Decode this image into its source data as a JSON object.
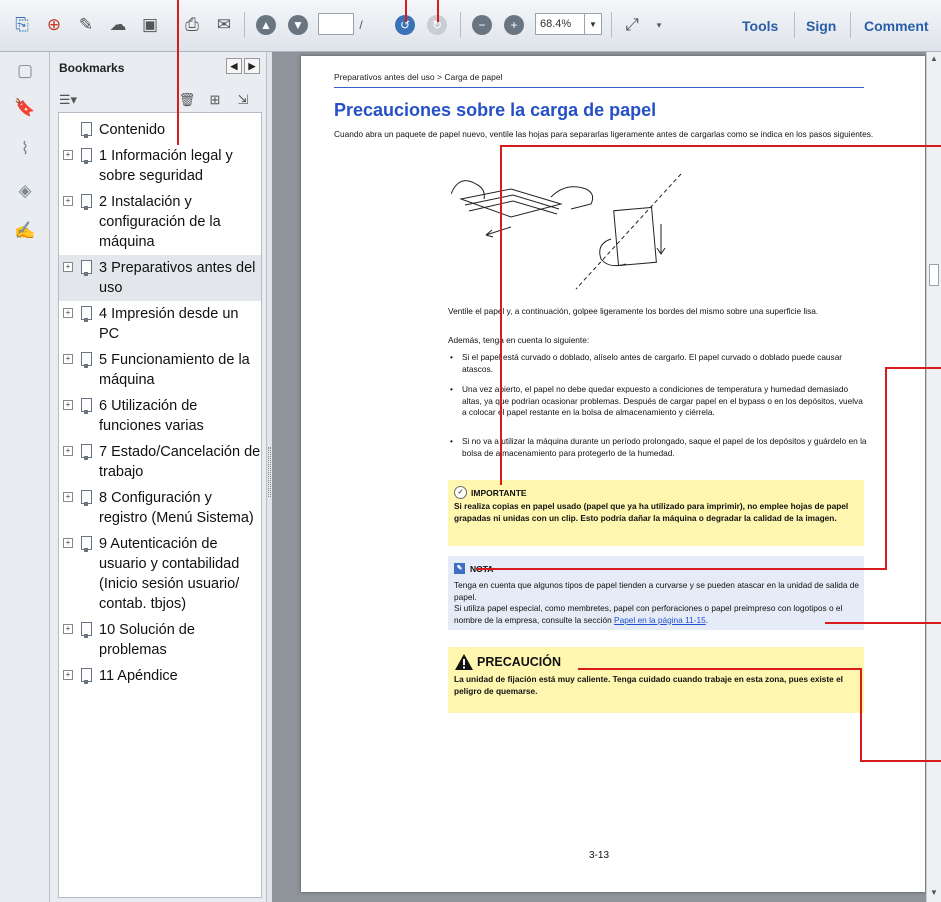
{
  "toolbar": {
    "page_current": "",
    "page_separator": "/",
    "page_total": "",
    "zoom": "68.4%",
    "tools_label": "Tools",
    "sign_label": "Sign",
    "comment_label": "Comment"
  },
  "bookmarks": {
    "title": "Bookmarks",
    "items": [
      {
        "label": "Contenido",
        "expandable": false,
        "selected": false
      },
      {
        "label": "1 Información legal y sobre seguridad",
        "expandable": true,
        "selected": false
      },
      {
        "label": "2 Instalación y configuración de la máquina",
        "expandable": true,
        "selected": false
      },
      {
        "label": "3 Preparativos antes del uso",
        "expandable": true,
        "selected": true
      },
      {
        "label": "4 Impresión desde un PC",
        "expandable": true,
        "selected": false
      },
      {
        "label": "5 Funcionamiento de la máquina",
        "expandable": true,
        "selected": false
      },
      {
        "label": "6 Utilización de funciones varias",
        "expandable": true,
        "selected": false
      },
      {
        "label": "7 Estado/Cancelación de trabajo",
        "expandable": true,
        "selected": false
      },
      {
        "label": "8 Configuración y registro (Menú Sistema)",
        "expandable": true,
        "selected": false
      },
      {
        "label": "9 Autenticación de usuario y contabilidad (Inicio sesión usuario/ contab. tbjos)",
        "expandable": true,
        "selected": false
      },
      {
        "label": "10 Solución de problemas",
        "expandable": true,
        "selected": false
      },
      {
        "label": "11 Apéndice",
        "expandable": true,
        "selected": false
      }
    ]
  },
  "document": {
    "breadcrumb": "Preparativos antes del uso > Carga de papel",
    "title": "Precauciones sobre la carga de papel",
    "intro": "Cuando abra un paquete de papel nuevo, ventile las hojas para separarlas ligeramente antes de cargarlas como se indica en los pasos siguientes.",
    "para1": "Ventile el papel y, a continuación, golpee ligeramente los bordes del mismo sobre una superficie lisa.",
    "para2": "Además, tenga en cuenta lo siguiente:",
    "bullet1": "Si el papel está curvado o doblado, alíselo antes de cargarlo. El papel curvado o doblado puede causar atascos.",
    "bullet2": "Una vez abierto, el papel no debe quedar expuesto a condiciones de temperatura y humedad demasiado altas, ya que podrían ocasionar problemas. Después de cargar papel en el bypass o en los depósitos, vuelva a colocar el papel restante en la bolsa de almacenamiento y ciérrela.",
    "bullet3": "Si no va a utilizar la máquina durante un período prolongado, saque el papel de los depósitos y guárdelo en la bolsa de almacenamiento para protegerlo de la humedad.",
    "important_title": "IMPORTANTE",
    "important_body": "Si realiza copias en papel usado (papel que ya ha utilizado para imprimir), no emplee hojas de papel grapadas ni unidas con un clip. Esto podría dañar la máquina o degradar la calidad de la imagen.",
    "note_title": "NOTA",
    "note_body1": "Tenga en cuenta que algunos tipos de papel tienden a curvarse y se pueden atascar en la unidad de salida de papel.",
    "note_body2": "Si utiliza papel especial, como membretes, papel con perforaciones o papel preimpreso con logotipos o el nombre de la empresa, consulte la sección",
    "note_link": "Papel en la página 11-15",
    "note_end": ".",
    "caution_title": "PRECAUCIÓN",
    "caution_body": "La unidad de fijación está muy caliente. Tenga cuidado cuando trabaje en esta zona, pues existe el peligro de quemarse.",
    "page_number": "3-13"
  },
  "colors": {
    "title_blue": "#2650c8",
    "callout_red": "#d61c1c",
    "important_bg": "#fff7b0",
    "note_bg": "#e6ecf7"
  }
}
